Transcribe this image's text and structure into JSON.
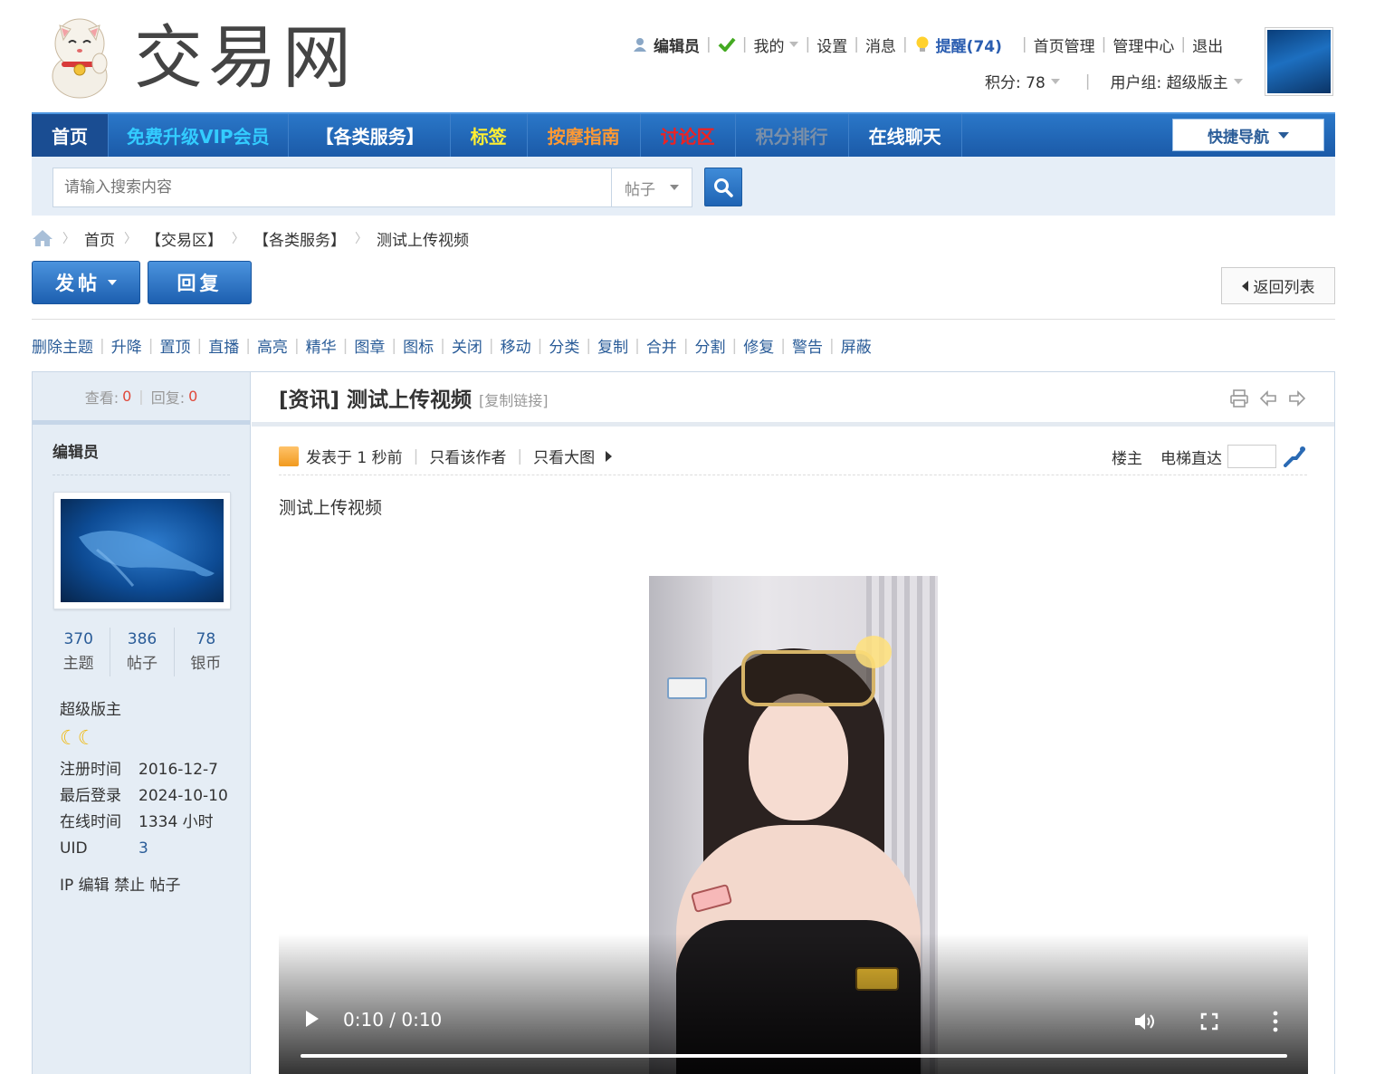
{
  "site": {
    "name": "交易网"
  },
  "user_bar": {
    "username": "编辑员",
    "mine": "我的",
    "settings": "设置",
    "messages": "消息",
    "remind": "提醒(74)",
    "home_manage": "首页管理",
    "admin_center": "管理中心",
    "logout": "退出",
    "points": "积分: 78",
    "usergroup": "用户组: 超级版主"
  },
  "nav": {
    "items": [
      {
        "label": "首页",
        "color": "#ffffff"
      },
      {
        "label": "免费升级VIP会员",
        "color": "#33ccff"
      },
      {
        "label": "【各类服务】",
        "color": "#ffffff"
      },
      {
        "label": "标签",
        "color": "#ffee33"
      },
      {
        "label": "按摩指南",
        "color": "#ff9933"
      },
      {
        "label": "讨论区",
        "color": "#ee2222"
      },
      {
        "label": "积分排行",
        "color": "#7a8fa8"
      },
      {
        "label": "在线聊天",
        "color": "#ffffff"
      }
    ],
    "quick_nav": "快捷导航"
  },
  "search": {
    "placeholder": "请输入搜索内容",
    "type": "帖子"
  },
  "breadcrumb": [
    "首页",
    "【交易区】",
    "【各类服务】",
    "测试上传视频"
  ],
  "actions": {
    "post": "发帖",
    "reply": "回复",
    "back": "返回列表"
  },
  "mod_tools": [
    "删除主题",
    "升降",
    "置顶",
    "直播",
    "高亮",
    "精华",
    "图章",
    "图标",
    "关闭",
    "移动",
    "分类",
    "复制",
    "合并",
    "分割",
    "修复",
    "警告",
    "屏蔽"
  ],
  "thread": {
    "views_label": "查看:",
    "views": "0",
    "replies_label": "回复:",
    "replies": "0",
    "category": "[资讯]",
    "title": "测试上传视频",
    "copy_link": "[复制链接]",
    "posted": "发表于 1 秒前",
    "only_author": "只看该作者",
    "only_images": "只看大图",
    "floor": "楼主",
    "jump_label": "电梯直达",
    "body": "测试上传视频"
  },
  "author": {
    "name": "编辑员",
    "stats": [
      {
        "value": "370",
        "label": "主题"
      },
      {
        "value": "386",
        "label": "帖子"
      },
      {
        "value": "78",
        "label": "银币"
      }
    ],
    "group": "超级版主",
    "moons": "☾☾",
    "profile": [
      {
        "key": "注册时间",
        "value": "2016-12-7"
      },
      {
        "key": "最后登录",
        "value": "2024-10-10"
      },
      {
        "key": "在线时间",
        "value": "1334 小时"
      },
      {
        "key": "UID",
        "value": "3"
      }
    ],
    "admin_links": "IP 编辑 禁止 帖子"
  },
  "video": {
    "time": "0:10 / 0:10",
    "progress": 1.0
  }
}
